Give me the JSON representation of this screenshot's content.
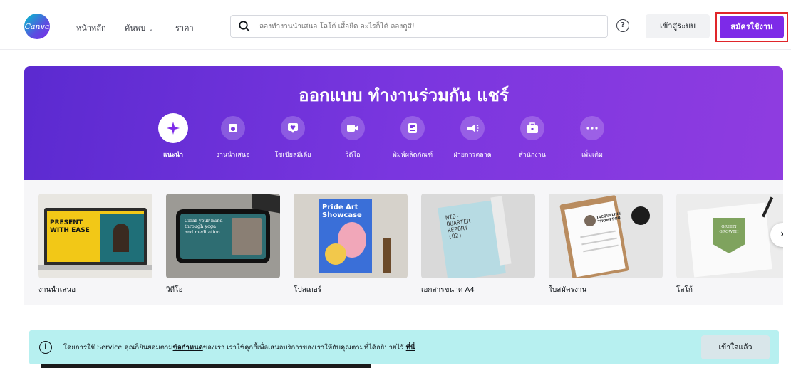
{
  "header": {
    "logo_text": "Canva",
    "nav": {
      "home": "หน้าหลัก",
      "explore": "ค้นพบ",
      "pricing": "ราคา"
    },
    "search": {
      "placeholder": "ลองทำงานนำเสนอ โลโก้ เสื้อยืด อะไรก็ได้ ลองดูสิ!"
    },
    "help_icon": "?",
    "login_label": "เข้าสู่ระบบ",
    "signup_label": "สมัครใช้งาน"
  },
  "hero": {
    "title": "ออกแบบ ทำงานร่วมกัน แชร์",
    "categories": [
      {
        "label": "แนะนำ",
        "icon": "sparkle-icon",
        "active": true
      },
      {
        "label": "งานนำเสนอ",
        "icon": "presentation-icon"
      },
      {
        "label": "โซเชียลมีเดีย",
        "icon": "heart-chat-icon"
      },
      {
        "label": "วิดีโอ",
        "icon": "video-camera-icon"
      },
      {
        "label": "พิมพ์ผลิตภัณฑ์",
        "icon": "print-icon"
      },
      {
        "label": "ฝ่ายการตลาด",
        "icon": "megaphone-icon"
      },
      {
        "label": "สำนักงาน",
        "icon": "briefcase-icon"
      },
      {
        "label": "เพิ่มเติม",
        "icon": "more-icon"
      }
    ]
  },
  "carousel": {
    "items": [
      {
        "label": "งานนำเสนอ",
        "thumb_text": "PRESENT WITH EASE"
      },
      {
        "label": "วิดีโอ",
        "thumb_text": "Clear your mind through yoga and meditation."
      },
      {
        "label": "โปสเตอร์",
        "thumb_text": "Pride Art Showcase"
      },
      {
        "label": "เอกสารขนาด A4",
        "thumb_text": "MID-QUARTER REPORT (Q2)"
      },
      {
        "label": "ใบสมัครงาน",
        "thumb_text": "JACQUELINE THOMPSON"
      },
      {
        "label": "โลโก้",
        "thumb_text": "GREEN GROWTH"
      }
    ],
    "next_icon": "›"
  },
  "cookie": {
    "text_before": "โดยการใช้ Service คุณก็ยินยอมตาม",
    "terms_link": "ข้อกำหนด",
    "text_middle": "ของเรา เราใช้คุกกี้เพื่อเสนอบริการของเราให้กับคุณตามที่ได้อธิบายไว้",
    "here_link": "ที่นี่",
    "accept_label": "เข้าใจแล้ว"
  },
  "colors": {
    "brand_purple": "#7d2ae8",
    "highlight_red": "#e0262a",
    "cookie_bg": "#b7f0f0"
  }
}
